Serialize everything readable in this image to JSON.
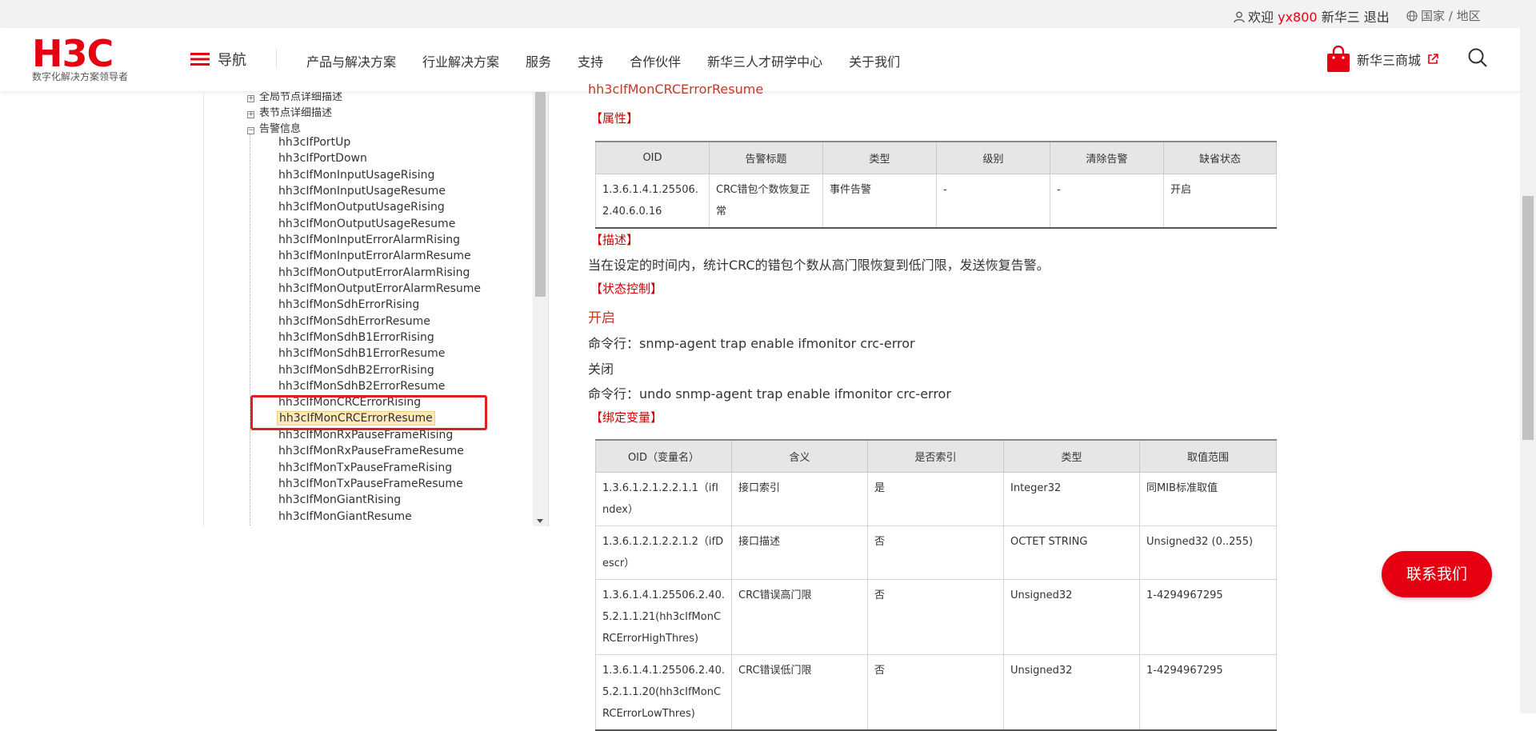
{
  "topbar": {
    "welcome": "欢迎",
    "username": "yx800",
    "company": "新华三",
    "logout": "退出",
    "region": "国家 / 地区"
  },
  "header": {
    "logo": "H3C",
    "tagline": "数字化解决方案领导者",
    "nav_toggle": "导航",
    "menu": [
      "产品与解决方案",
      "行业解决方案",
      "服务",
      "支持",
      "合作伙伴",
      "新华三人才研学中心",
      "关于我们"
    ],
    "shop": "新华三商城"
  },
  "tree": {
    "nodes": [
      "全局节点详细描述",
      "表节点详细描述",
      "告警信息"
    ],
    "leaves": [
      "hh3cIfPortUp",
      "hh3cIfPortDown",
      "hh3cIfMonInputUsageRising",
      "hh3cIfMonInputUsageResume",
      "hh3cIfMonOutputUsageRising",
      "hh3cIfMonOutputUsageResume",
      "hh3cIfMonInputErrorAlarmRising",
      "hh3cIfMonInputErrorAlarmResume",
      "hh3cIfMonOutputErrorAlarmRising",
      "hh3cIfMonOutputErrorAlarmResume",
      "hh3cIfMonSdhErrorRising",
      "hh3cIfMonSdhErrorResume",
      "hh3cIfMonSdhB1ErrorRising",
      "hh3cIfMonSdhB1ErrorResume",
      "hh3cIfMonSdhB2ErrorRising",
      "hh3cIfMonSdhB2ErrorResume",
      "hh3cIfMonCRCErrorRising",
      "hh3cIfMonCRCErrorResume",
      "hh3cIfMonRxPauseFrameRising",
      "hh3cIfMonRxPauseFrameResume",
      "hh3cIfMonTxPauseFrameRising",
      "hh3cIfMonTxPauseFrameResume",
      "hh3cIfMonGiantRising",
      "hh3cIfMonGiantResume"
    ],
    "selected": "hh3cIfMonCRCErrorResume"
  },
  "content": {
    "cut_title": "hh3cIfMonCRCErrorResume",
    "attr_heading": "【属性】",
    "attr_table": {
      "headers": [
        "OID",
        "告警标题",
        "类型",
        "级别",
        "清除告警",
        "缺省状态"
      ],
      "row": [
        "1.3.6.1.4.1.25506.2.40.6.0.16",
        "CRC错包个数恢复正常",
        "事件告警",
        "-",
        "-",
        "开启"
      ]
    },
    "desc_heading": "【描述】",
    "desc_text": "当在设定的时间内，统计CRC的错包个数从高门限恢复到低门限，发送恢复告警。",
    "state_heading": "【状态控制】",
    "state_on": "开启",
    "cmd_on": "命令行：snmp-agent trap enable ifmonitor crc-error",
    "state_off": "关闭",
    "cmd_off": "命令行：undo snmp-agent trap enable ifmonitor crc-error",
    "bind_heading": "【绑定变量】",
    "bind_table": {
      "headers": [
        "OID（变量名）",
        "含义",
        "是否索引",
        "类型",
        "取值范围"
      ],
      "rows": [
        [
          "1.3.6.1.2.1.2.2.1.1（ifIndex）",
          "接口索引",
          "是",
          "Integer32",
          "同MIB标准取值"
        ],
        [
          "1.3.6.1.2.1.2.2.1.2（ifDescr）",
          "接口描述",
          "否",
          "OCTET STRING",
          "Unsigned32 (0..255)"
        ],
        [
          "1.3.6.1.4.1.25506.2.40.5.2.1.1.21(hh3cIfMonCRCErrorHighThres)",
          "CRC错误高门限",
          "否",
          "Unsigned32",
          "1-4294967295"
        ],
        [
          "1.3.6.1.4.1.25506.2.40.5.2.1.1.20(hh3cIfMonCRCErrorLowThres)",
          "CRC错误低门限",
          "否",
          "Unsigned32",
          "1-4294967295"
        ]
      ]
    }
  },
  "contact_button": "联系我们"
}
